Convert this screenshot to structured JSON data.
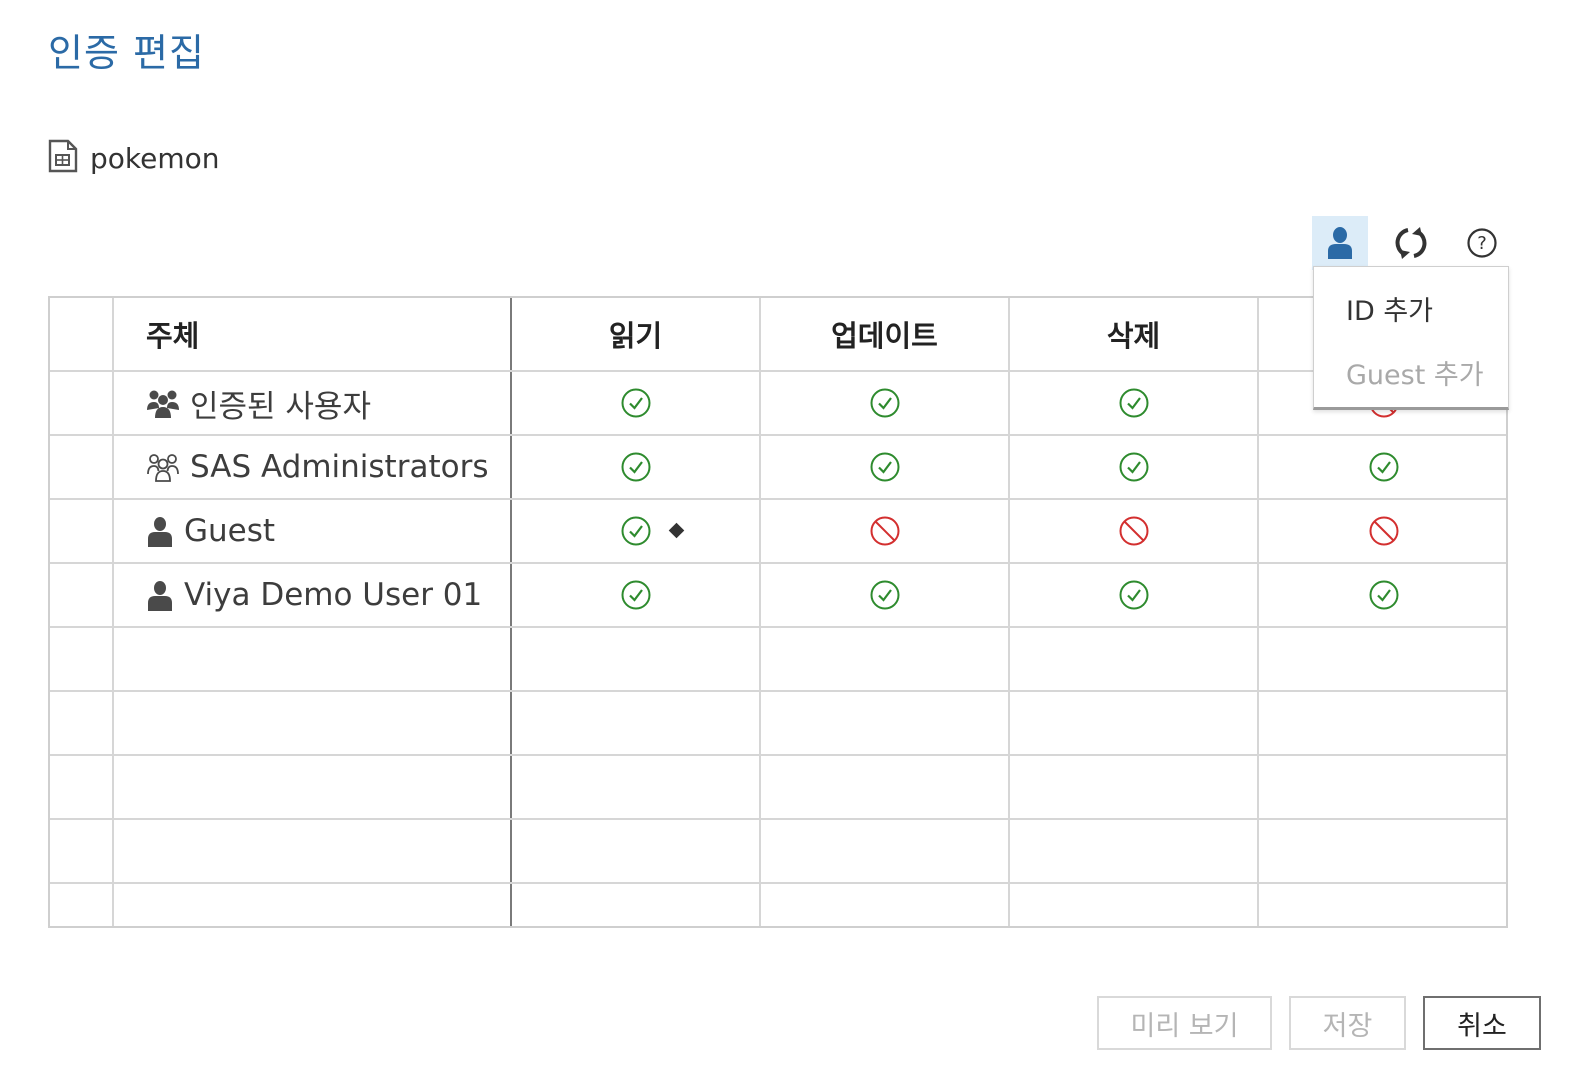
{
  "dialog": {
    "title": "인증 편집"
  },
  "object": {
    "name": "pokemon",
    "icon": "document-icon"
  },
  "toolbar": {
    "add_identity_icon": "user-icon",
    "refresh_icon": "refresh-icon",
    "help_icon": "help-icon"
  },
  "menu": {
    "items": [
      {
        "label": "ID 추가"
      },
      {
        "label": "Guest 추가"
      }
    ]
  },
  "table": {
    "headers": [
      "주체",
      "읽기",
      "업데이트",
      "삭제",
      ""
    ],
    "rows": [
      {
        "subject": "인증된 사용자",
        "icon": "group-icon",
        "permissions": [
          "grant",
          "grant",
          "grant",
          "prohibit"
        ]
      },
      {
        "subject": "SAS Administrators",
        "icon": "group-outline-icon",
        "permissions": [
          "grant",
          "grant",
          "grant",
          "grant"
        ]
      },
      {
        "subject": "Guest",
        "icon": "user-icon",
        "permissions": [
          "grant",
          "prohibit",
          "prohibit",
          "prohibit"
        ],
        "conditional_read": true
      },
      {
        "subject": "Viya Demo User 01",
        "icon": "user-icon",
        "permissions": [
          "grant",
          "grant",
          "grant",
          "grant"
        ]
      }
    ]
  },
  "colors": {
    "title": "#2b6aa6",
    "grant": "#2e8b2e",
    "prohibit": "#d32f2f",
    "active_toolbar": "#dcecf8"
  },
  "buttons": {
    "preview": "미리 보기",
    "save": "저장",
    "cancel": "취소"
  }
}
